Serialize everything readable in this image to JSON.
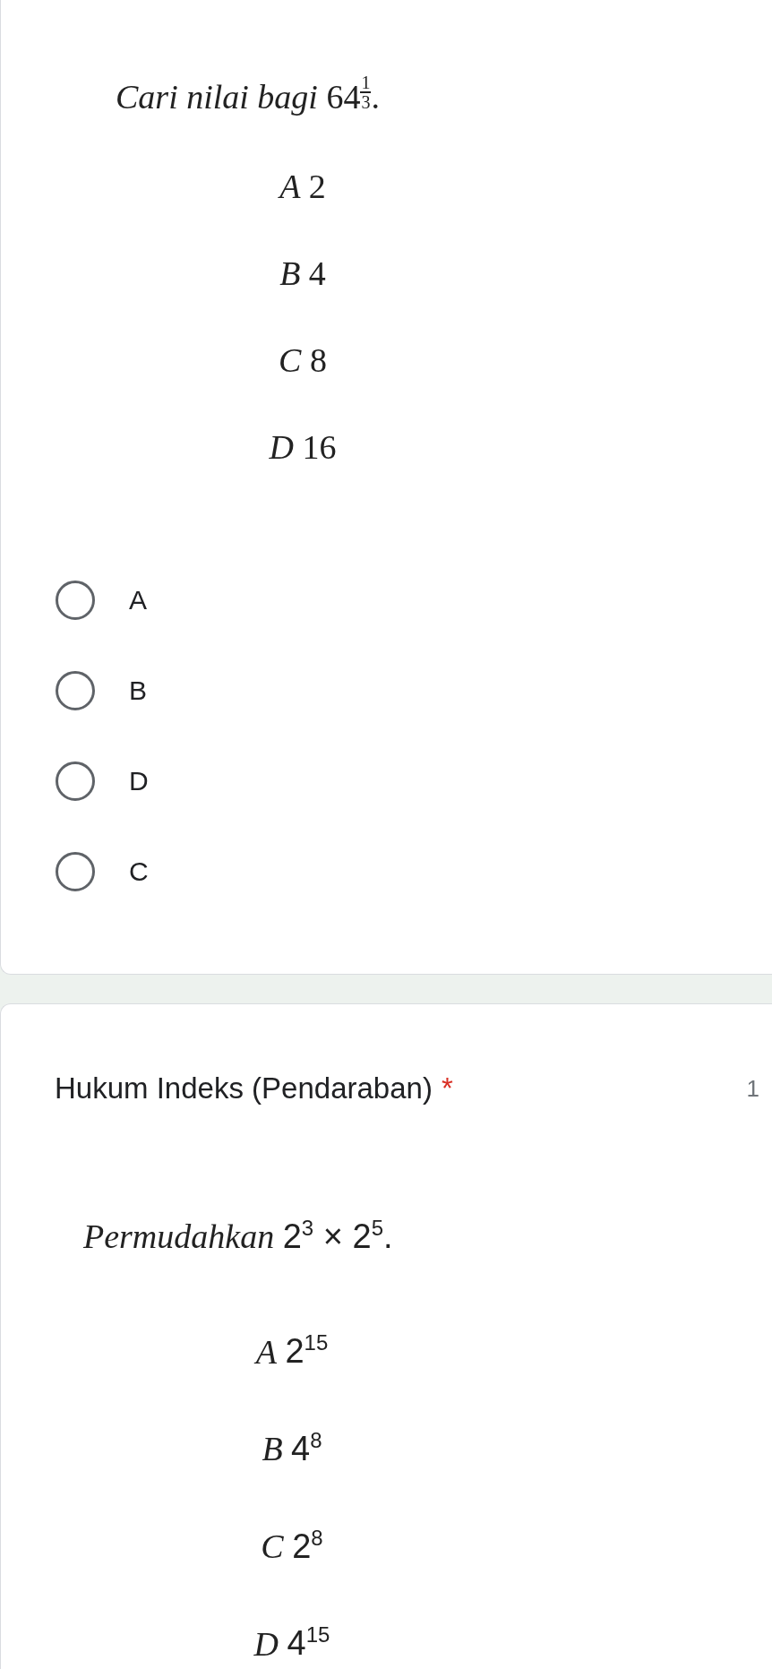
{
  "question_1": {
    "text": "Cari nilai bagi ",
    "base": "64",
    "exponent_numerator": "1",
    "exponent_denominator": "3",
    "tail": ".",
    "options": [
      {
        "letter": "A",
        "value": "2"
      },
      {
        "letter": "B",
        "value": "4"
      },
      {
        "letter": "C",
        "value": "8"
      },
      {
        "letter": "D",
        "value": "16"
      }
    ],
    "choices": [
      {
        "label": "A",
        "selected": false
      },
      {
        "label": "B",
        "selected": false
      },
      {
        "label": "D",
        "selected": false
      },
      {
        "label": "C",
        "selected": false
      }
    ]
  },
  "question_2": {
    "title": "Hukum Indeks (Pendaraban)",
    "required_mark": "*",
    "points": "1",
    "prompt": "Permudahkan",
    "expression": "2$^{3}$ × 2$^{5}$.",
    "options": [
      {
        "letter": "A",
        "value": "2$^{15}$"
      },
      {
        "letter": "B",
        "value": "4$^{8}$"
      },
      {
        "letter": "C",
        "value": "2$^{8}$"
      },
      {
        "letter": "D",
        "value": "4$^{15}$"
      }
    ]
  }
}
